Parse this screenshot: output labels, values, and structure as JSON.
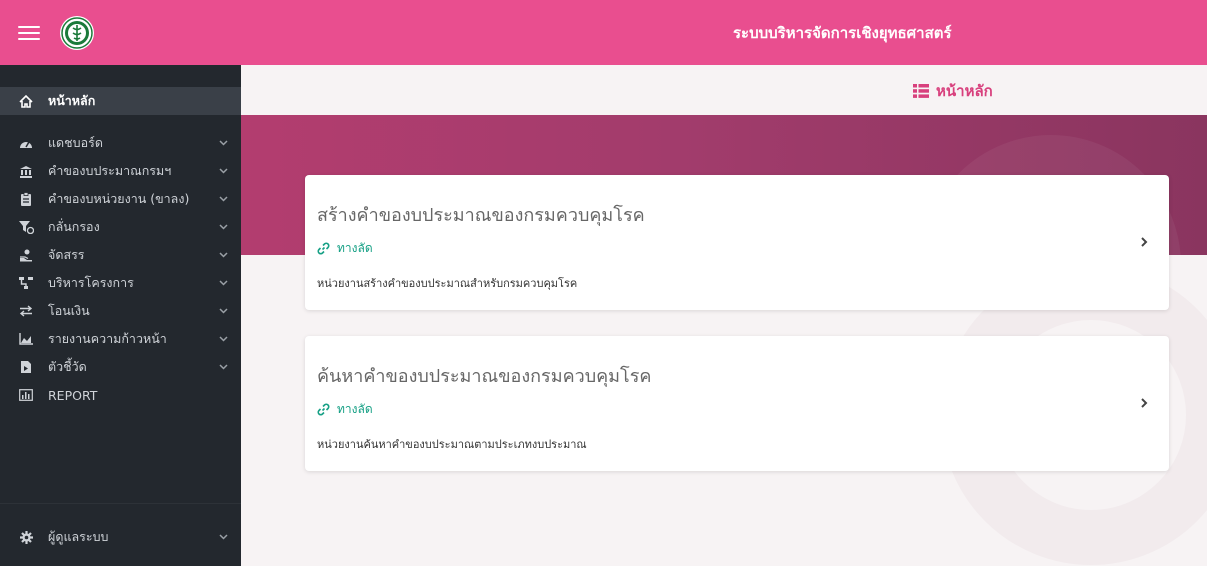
{
  "topbar": {
    "title": "ระบบบริหารจัดการเชิงยุทธศาสตร์"
  },
  "sidebar": {
    "items": [
      {
        "label": "หน้าหลัก",
        "icon": "home-icon",
        "active": true
      },
      {
        "label": "แดชบอร์ด",
        "icon": "dashboard-icon"
      },
      {
        "label": "คำของบประมาณกรมฯ",
        "icon": "bank-icon"
      },
      {
        "label": "คำของบหน่วยงาน (ขาลง)",
        "icon": "clipboard-icon"
      },
      {
        "label": "กลั่นกรอง",
        "icon": "filter-icon"
      },
      {
        "label": "จัดสรร",
        "icon": "allocate-icon"
      },
      {
        "label": "บริหารโครงการ",
        "icon": "project-icon"
      },
      {
        "label": "โอนเงิน",
        "icon": "transfer-icon"
      },
      {
        "label": "รายงานความก้าวหน้า",
        "icon": "area-chart-icon"
      },
      {
        "label": "ตัวชี้วัด",
        "icon": "indicator-icon"
      },
      {
        "label": "REPORT",
        "icon": "bar-chart-icon"
      },
      {
        "label": "ผู้ดูแลระบบ",
        "icon": "cog-icon"
      }
    ]
  },
  "main": {
    "page_title": "หน้าหลัก",
    "cards": [
      {
        "title": "สร้างคำของบประมาณของกรมควบคุมโรค",
        "shortcut": "ทางลัด",
        "description": "หน่วยงานสร้างคำของบประมาณสำหรับกรมควบคุมโรค"
      },
      {
        "title": "ค้นหาคำของบประมาณของกรมควบคุมโรค",
        "shortcut": "ทางลัด",
        "description": "หน่วยงานค้นหาคำของบประมาณตามประเภทงบประมาณ"
      }
    ]
  },
  "colors": {
    "topbar": "#e94e8f",
    "sidebar": "#23282e",
    "accent": "#d8407d",
    "shortcut": "#16a085"
  }
}
